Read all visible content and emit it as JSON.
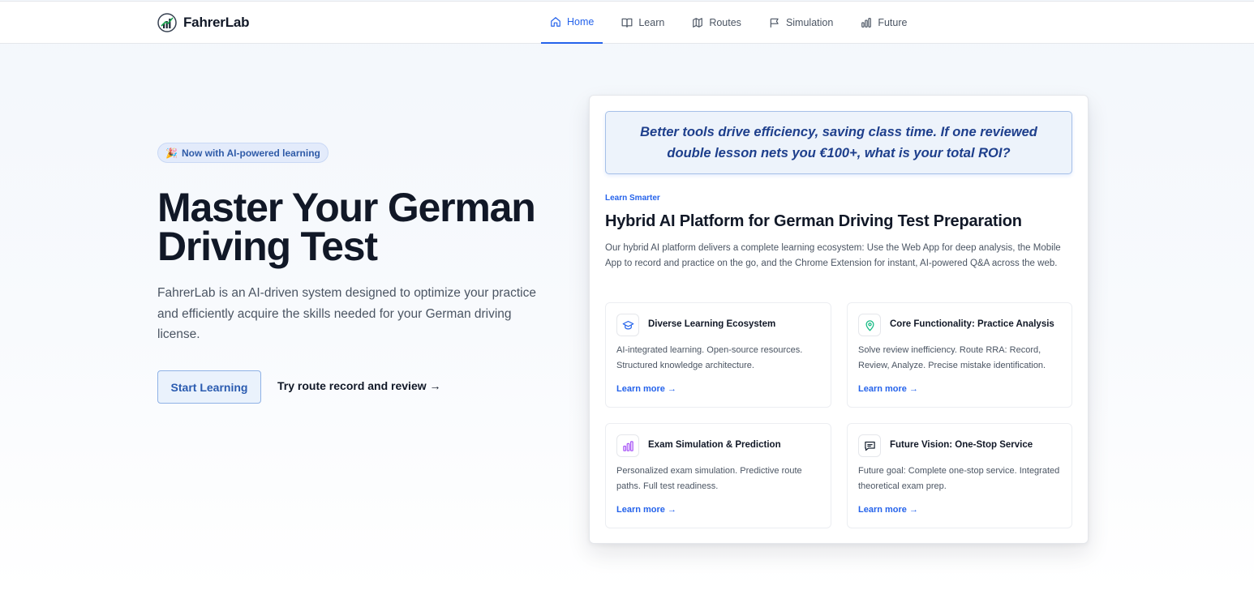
{
  "brand": {
    "name": "FahrerLab",
    "logo_icon": "chart-logo-icon"
  },
  "nav": {
    "items": [
      {
        "label": "Home",
        "icon": "home-icon",
        "active": true
      },
      {
        "label": "Learn",
        "icon": "book-icon",
        "active": false
      },
      {
        "label": "Routes",
        "icon": "map-icon",
        "active": false
      },
      {
        "label": "Simulation",
        "icon": "flag-icon",
        "active": false
      },
      {
        "label": "Future",
        "icon": "bar-chart-icon",
        "active": false
      }
    ]
  },
  "hero": {
    "badge_emoji": "🎉",
    "badge": "Now with AI-powered learning",
    "title_line1": "Master Your German",
    "title_line2": "Driving Test",
    "description": "FahrerLab is an AI-driven system designed to optimize your practice and efficiently acquire the skills needed for your German driving license.",
    "primary_button": "Start Learning",
    "secondary_link": "Try route record and review →"
  },
  "card": {
    "quote": "Better tools drive efficiency, saving class time. If one reviewed double lesson nets you €100+, what is your total ROI?",
    "eyebrow": "Learn Smarter",
    "title": "Hybrid AI Platform for German Driving Test Preparation",
    "description": "Our hybrid AI platform delivers a complete learning ecosystem: Use the Web App for deep analysis, the Mobile App to record and practice on the go, and the Chrome Extension for instant, AI-powered Q&A across the web.",
    "features": [
      {
        "icon": "graduation-cap-icon",
        "title": "Diverse Learning Ecosystem",
        "description": "AI-integrated learning. Open-source resources. Structured knowledge architecture.",
        "link": "Learn more →"
      },
      {
        "icon": "map-pin-icon",
        "title": "Core Functionality: Practice Analysis",
        "description": "Solve review inefficiency. Route RRA: Record, Review, Analyze. Precise mistake identification.",
        "link": "Learn more →"
      },
      {
        "icon": "bar-chart-icon",
        "title": "Exam Simulation & Prediction",
        "description": "Personalized exam simulation. Predictive route paths. Full test readiness.",
        "link": "Learn more →"
      },
      {
        "icon": "message-icon",
        "title": "Future Vision: One-Stop Service",
        "description": "Future goal: Complete one-stop service. Integrated theoretical exam prep.",
        "link": "Learn more →"
      }
    ]
  },
  "colors": {
    "accent": "#2563eb",
    "text": "#111827",
    "muted": "#4b5563",
    "map_pin": "#10b981",
    "chart_purple": "#a855f7"
  }
}
